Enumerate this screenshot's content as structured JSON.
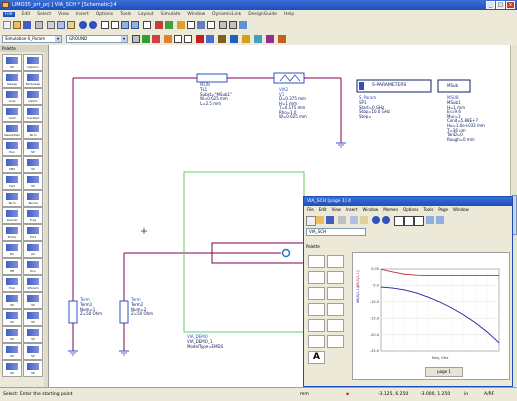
{
  "window": {
    "title": "LIMO35_prt_prj ] VIA_SCH * [Schematic]:4",
    "buttons": [
      "_",
      "□",
      "x"
    ]
  },
  "menu": [
    "File",
    "Edit",
    "Select",
    "View",
    "Insert",
    "Options",
    "Tools",
    "Layout",
    "Simulate",
    "Window",
    "DynamicLink",
    "DesignGuide",
    "Help"
  ],
  "combos": {
    "palette_select": "Simulation-S_Param",
    "component_select": "GROUND"
  },
  "palette": {
    "title": "Palette",
    "items": [
      "SP",
      "Options",
      "Sweep",
      "ParSweep",
      "Goal",
      "Optim",
      "Yield",
      "YieldOpt",
      "SweepPlan",
      "Term",
      "Eqn",
      "SP",
      "SMS",
      "SP",
      "Fwd",
      "SP",
      "Term",
      "TermG",
      "Deemb",
      "Freq",
      "Probe",
      "Port",
      "DC",
      "AC",
      "HB",
      "Env",
      "Tran",
      "SParam",
      "SP",
      "SP",
      "SP",
      "SP",
      "SP",
      "SP",
      "SP",
      "SP",
      "SP",
      "SP",
      "SP",
      "SP"
    ]
  },
  "schematic": {
    "mlin": [
      "MLIN",
      "TL1",
      "Subst=\"MSub1\"",
      "W=0.625 mm",
      "L=2.5 mm"
    ],
    "via": [
      "VIA2",
      "V1",
      "D=0.375 mm",
      "H=1 mm",
      "T=0.175 mm",
      "Rho=1.0",
      "W=0.625 mm"
    ],
    "sp_box": "S-PARAMETERS",
    "sp": [
      "S_Param",
      "SP1",
      "Start=0 GHz",
      "Stop=10.0 GHz",
      "Step="
    ],
    "msub_box": "MSub",
    "msub": [
      "MSUB",
      "MSub1",
      "H=1 mm",
      "Er=9.6",
      "Mur=1",
      "Cond=5.88E+7",
      "Hu=1.0e+033 mm",
      "T=36 um",
      "TanD=0",
      "Rough=0 mm"
    ],
    "term1": [
      "Term",
      "Term1",
      "Num=1",
      "Z=50 Ohm"
    ],
    "term2": [
      "Term",
      "Term2",
      "Num=2",
      "Z=50 Ohm"
    ],
    "via_demo": [
      "VIA_DEMO",
      "VIA_DEMO_1",
      "ModelType=EMDS"
    ]
  },
  "subwindow": {
    "title": "VIA_SCH [page 1] 4",
    "menu": [
      "File",
      "Edit",
      "View",
      "Insert",
      "Window",
      "Momen",
      "Options",
      "Tools",
      "Page",
      "Window"
    ],
    "combo": "VIA_SCH",
    "palette_title": "Palette",
    "tab": "page 1",
    "chart_legend": [
      "dB(S(2,1))",
      "dB(S(1,1))"
    ]
  },
  "chart_data": {
    "type": "line",
    "xlabel": "freq, GHz",
    "ylabel": "",
    "ylim": [
      -25,
      0
    ],
    "xlim": [
      0,
      10
    ],
    "yticks": [
      "0.00",
      "-5.0",
      "-10.0",
      "-15.0",
      "-20.0",
      "-25.0"
    ],
    "series": [
      {
        "name": "dB(S(2,1))",
        "color": "#c03030",
        "x": [
          0,
          1,
          2,
          3,
          4,
          5,
          6,
          7,
          8,
          9,
          10
        ],
        "values": [
          -0.1,
          -0.9,
          -1.6,
          -1.9,
          -2.0,
          -2.0,
          -2.0,
          -2.0,
          -2.0,
          -2.0,
          -2.0
        ]
      },
      {
        "name": "dB(S(1,1))",
        "color": "#2020a0",
        "x": [
          0,
          1,
          2,
          3,
          4,
          5,
          6,
          7,
          8,
          9,
          10
        ],
        "values": [
          -5.5,
          -5.8,
          -6.4,
          -7.3,
          -8.6,
          -10.1,
          -11.9,
          -14.0,
          -16.4,
          -19.2,
          -22.5
        ]
      }
    ]
  },
  "status": {
    "message": "Select: Enter the starting point",
    "units": "mm",
    "coords1": "-3.125, 6.250",
    "coords2": "-3.000, 1.250",
    "unit2": "in",
    "mode": "A/RF"
  },
  "colors": {
    "wire": "#800050",
    "demo_box": "#60d060",
    "component": "#3050c0",
    "accent": "#1d4fb8"
  }
}
